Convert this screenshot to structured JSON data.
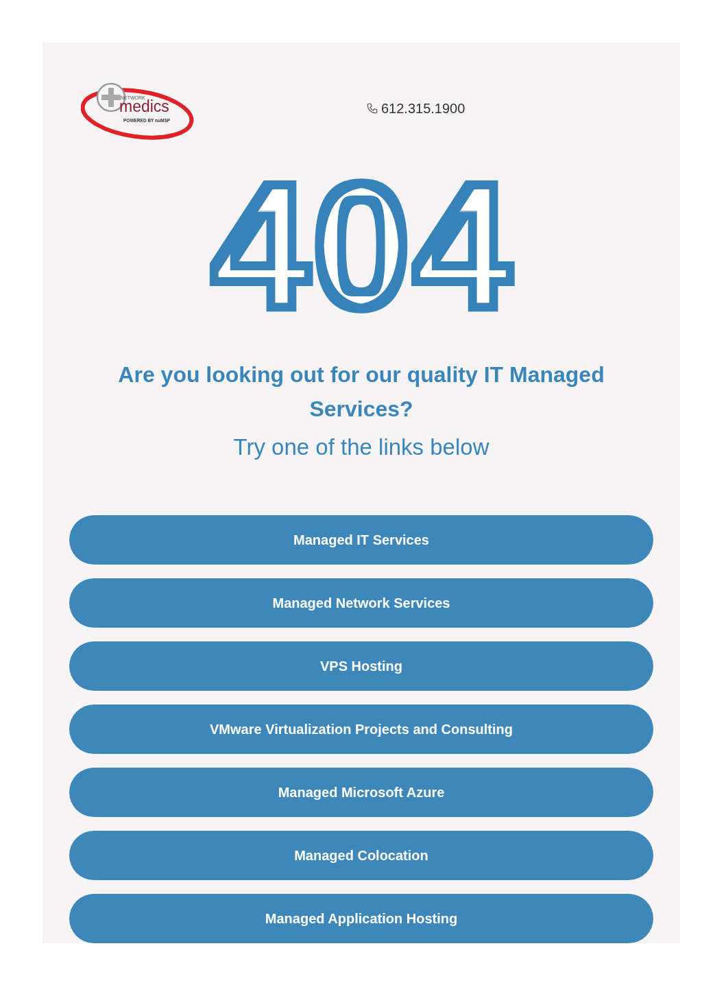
{
  "logo": {
    "top_word": "NETWORK",
    "main_word": "medics",
    "tagline": "POWERED BY nuMSP"
  },
  "phone": "612.315.1900",
  "error_code": "404",
  "headline": "Are you looking out for our quality IT Managed Services?",
  "subheadline": "Try one of the links below",
  "links": [
    {
      "label": "Managed IT Services"
    },
    {
      "label": "Managed Network Services"
    },
    {
      "label": "VPS Hosting"
    },
    {
      "label": "VMware Virtualization Projects and Consulting"
    },
    {
      "label": "Managed Microsoft Azure"
    },
    {
      "label": "Managed Colocation"
    },
    {
      "label": "Managed Application Hosting"
    }
  ]
}
